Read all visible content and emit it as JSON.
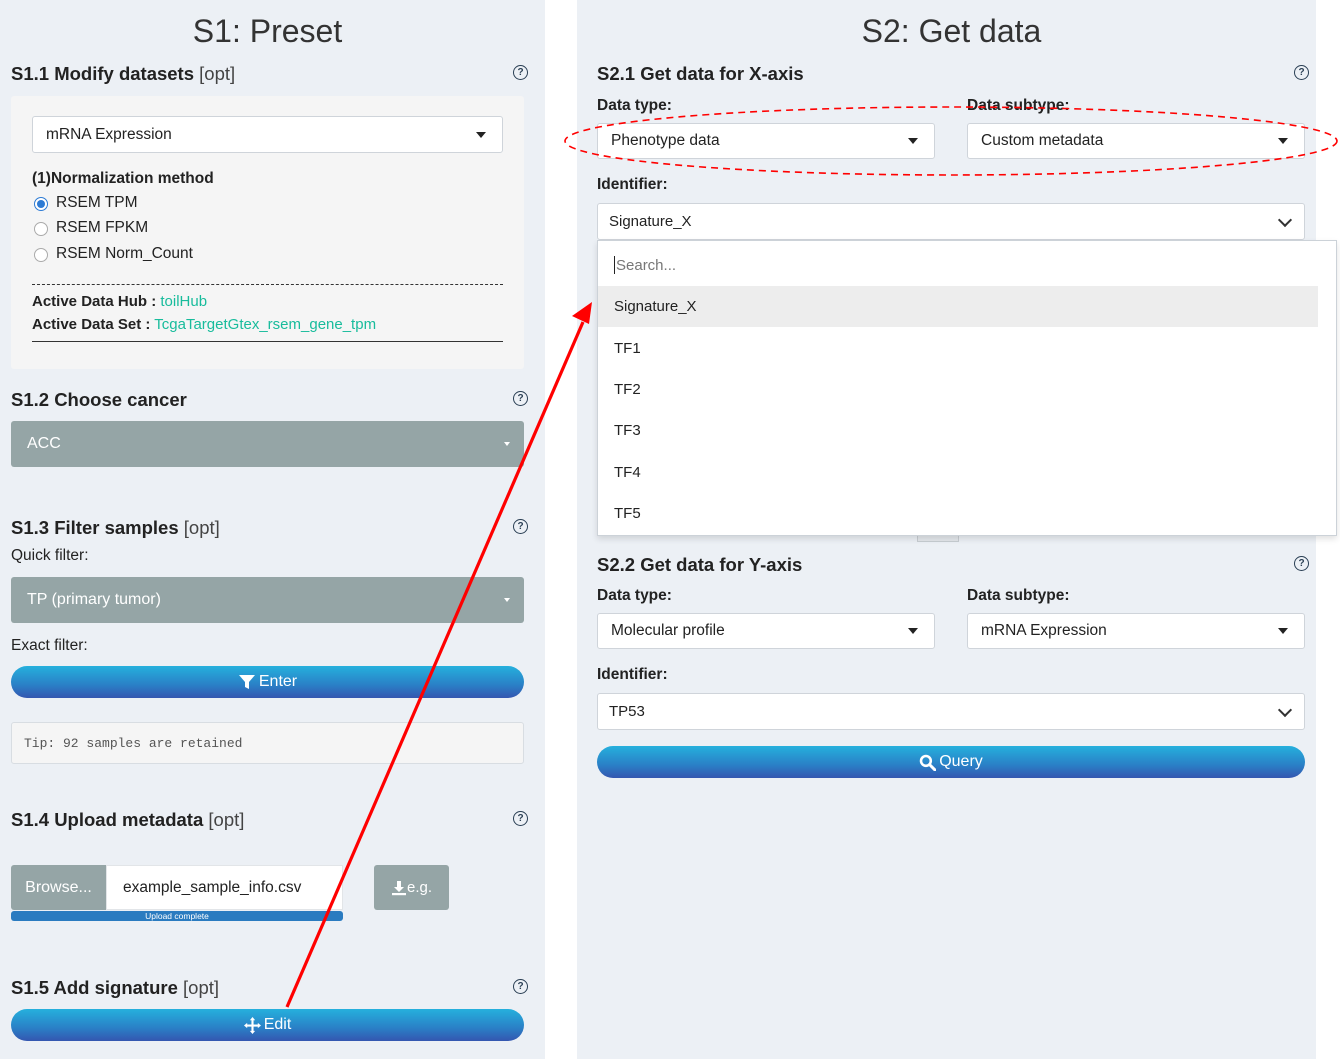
{
  "left": {
    "title": "S1: Preset",
    "s11": {
      "heading": "S1.1 Modify datasets",
      "opt": "[opt]",
      "dataset_select": "mRNA Expression",
      "norm_label": "(1)Normalization method",
      "options": [
        "RSEM TPM",
        "RSEM FPKM",
        "RSEM Norm_Count"
      ],
      "hub_label": "Active Data Hub :",
      "hub_value": "toilHub",
      "set_label": "Active Data Set :",
      "set_value": "TcgaTargetGtex_rsem_gene_tpm"
    },
    "s12": {
      "heading": "S1.2 Choose cancer",
      "cancer": "ACC"
    },
    "s13": {
      "heading": "S1.3 Filter samples",
      "opt": "[opt]",
      "quick_label": "Quick filter:",
      "quick_value": "TP (primary tumor)",
      "exact_label": "Exact filter:",
      "enter_label": "Enter",
      "tip": "Tip: 92 samples are retained"
    },
    "s14": {
      "heading": "S1.4 Upload metadata",
      "opt": "[opt]",
      "browse": "Browse...",
      "filename": "example_sample_info.csv",
      "progress_text": "Upload complete",
      "eg_label": "e.g."
    },
    "s15": {
      "heading": "S1.5 Add signature",
      "opt": "[opt]",
      "edit_label": "Edit"
    }
  },
  "right": {
    "title": "S2: Get data",
    "s21": {
      "heading": "S2.1 Get data for X-axis",
      "type_label": "Data type:",
      "type_value": "Phenotype data",
      "subtype_label": "Data subtype:",
      "subtype_value": "Custom metadata",
      "id_label": "Identifier:",
      "id_value": "Signature_X",
      "search_placeholder": "Search...",
      "dropdown_items": [
        "Signature_X",
        "TF1",
        "TF2",
        "TF3",
        "TF4",
        "TF5"
      ]
    },
    "s22": {
      "heading": "S2.2 Get data for Y-axis",
      "type_label": "Data type:",
      "type_value": "Molecular profile",
      "subtype_label": "Data subtype:",
      "subtype_value": "mRNA Expression",
      "id_label": "Identifier:",
      "id_value": "TP53",
      "query_label": "Query"
    }
  },
  "help_icon": "?",
  "colors": {
    "annotation": "#ff0000",
    "link": "#18bc9c",
    "grey_select": "#95a5a6",
    "panel_bg": "#ecf0f5"
  }
}
